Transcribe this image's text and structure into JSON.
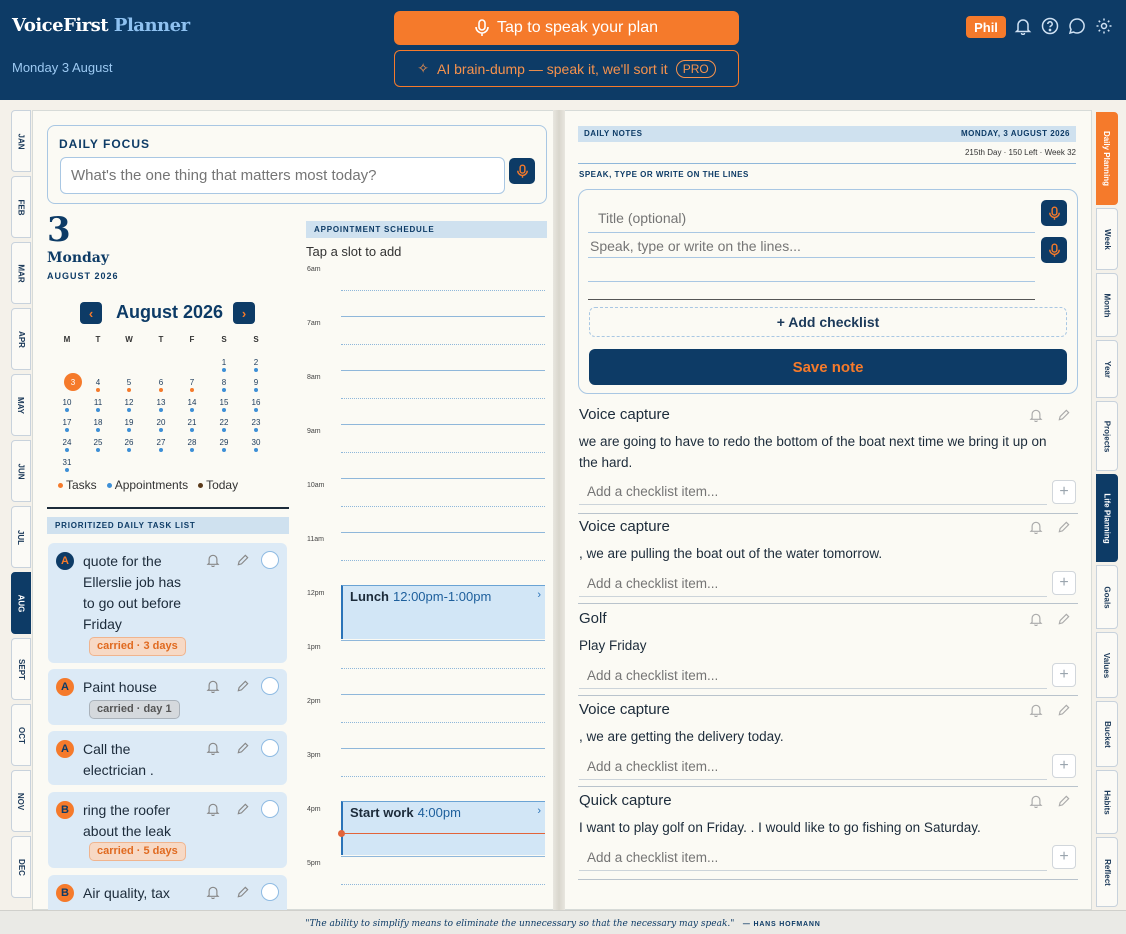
{
  "header": {
    "brand_part1": "VoiceFirst",
    "brand_part2": "Planner",
    "date": "Monday 3 August",
    "speak_label": "Tap to speak your plan",
    "brain_dump_label": "AI brain-dump — speak it, we'll sort it",
    "pro_label": "PRO",
    "user_name": "Phil"
  },
  "month_tabs": [
    "JAN",
    "FEB",
    "MAR",
    "APR",
    "MAY",
    "JUN",
    "JUL",
    "AUG",
    "SEPT",
    "OCT",
    "NOV",
    "DEC"
  ],
  "right_tabs": [
    "Daily Planning",
    "Week",
    "Month",
    "Year",
    "Projects",
    "Life Planning",
    "Goals",
    "Values",
    "Bucket",
    "Habits",
    "Reflect"
  ],
  "daily_focus": {
    "title": "DAILY FOCUS",
    "placeholder": "What's the one thing that matters most today?"
  },
  "date_block": {
    "day_number": "3",
    "weekday": "Monday",
    "month_year": "AUGUST 2026"
  },
  "calendar": {
    "title": "August 2026",
    "prev_label": "‹",
    "next_label": "›",
    "weekdays": [
      "M",
      "T",
      "W",
      "T",
      "F",
      "S",
      "S"
    ],
    "weeks": [
      [
        "",
        "",
        "",
        "",
        "",
        "1",
        "2"
      ],
      [
        "3",
        "4",
        "5",
        "6",
        "7",
        "8",
        "9"
      ],
      [
        "10",
        "11",
        "12",
        "13",
        "14",
        "15",
        "16"
      ],
      [
        "17",
        "18",
        "19",
        "20",
        "21",
        "22",
        "23"
      ],
      [
        "24",
        "25",
        "26",
        "27",
        "28",
        "29",
        "30"
      ],
      [
        "31",
        "",
        "",
        "",
        "",
        "",
        ""
      ]
    ],
    "legend": [
      "Tasks",
      "Appointments",
      "Today"
    ],
    "colors": {
      "tasks": "#f57a2b",
      "appointments": "#3d8fd6",
      "today": "#5a3a1a"
    }
  },
  "tasks": {
    "header": "PRIORITIZED DAILY TASK LIST",
    "items": [
      {
        "priority": "A",
        "text": "quote for the Ellerslie job has to go out before Friday",
        "carried": "carried · 3 days"
      },
      {
        "priority": "A",
        "text": "Paint house",
        "carried": "carried · day 1"
      },
      {
        "priority": "A",
        "text": "Call the electrician .",
        "carried": ""
      },
      {
        "priority": "B",
        "text": "ring the roofer about the leak",
        "carried": "carried · 5 days"
      },
      {
        "priority": "B",
        "text": "Air quality, tax",
        "carried": ""
      }
    ]
  },
  "schedule": {
    "header": "APPOINTMENT SCHEDULE",
    "hint": "Tap a slot to add",
    "hours": [
      "6am",
      "7am",
      "8am",
      "9am",
      "10am",
      "11am",
      "12pm",
      "1pm",
      "2pm",
      "3pm",
      "4pm",
      "5pm"
    ],
    "appointments": [
      {
        "title": "Lunch",
        "time": "12:00pm-1:00pm"
      },
      {
        "title": "Start work",
        "time": "4:00pm"
      }
    ]
  },
  "notes": {
    "header": "DAILY NOTES",
    "header_date": "MONDAY, 3 AUGUST 2026",
    "meta": "215th Day · 150 Left · Week 32",
    "subheader": "SPEAK, TYPE OR WRITE ON THE LINES",
    "title_placeholder": "Title (optional)",
    "body_placeholder": "Speak, type or write on the lines...",
    "add_checklist": "+ Add checklist",
    "save_label": "Save note",
    "checklist_placeholder": "Add a checklist item...",
    "items": [
      {
        "title": "Voice capture",
        "body": "we are going to have to redo the bottom of the boat next time we bring it up on the hard."
      },
      {
        "title": "Voice capture",
        "body": ", we are pulling the boat out of the water tomorrow."
      },
      {
        "title": "Golf",
        "body": "Play Friday"
      },
      {
        "title": "Voice capture",
        "body": ", we are getting the delivery today."
      },
      {
        "title": "Quick capture",
        "body": "I want to play golf on Friday. . I would like to go fishing on Saturday."
      }
    ]
  },
  "footer": {
    "quote": "\"The ability to simplify means to eliminate the unnecessary so that the necessary may speak.\"",
    "author": "— HANS HOFMANN"
  },
  "colors": {
    "navy": "#0d3b66",
    "orange": "#f57a2b",
    "paper": "#fbfaf4",
    "light_blue": "#dceaf6"
  }
}
